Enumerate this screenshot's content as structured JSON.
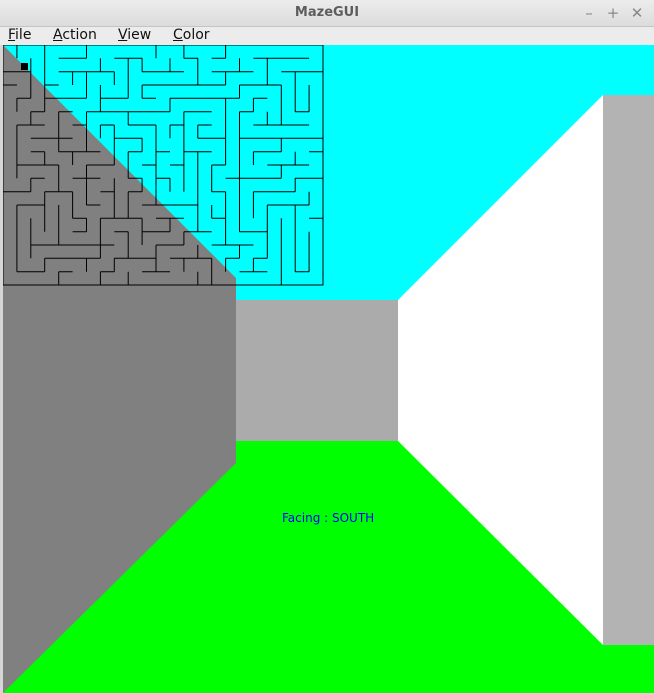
{
  "window": {
    "title": "MazeGUI"
  },
  "window_controls": {
    "minimize": "–",
    "maximize": "+",
    "close": "✕"
  },
  "menu": [
    {
      "label": "File",
      "mnemonic": "F",
      "rest": "ile"
    },
    {
      "label": "Action",
      "mnemonic": "A",
      "rest": "ction"
    },
    {
      "label": "View",
      "mnemonic": "V",
      "rest": "iew"
    },
    {
      "label": "Color",
      "mnemonic": "C",
      "rest": "olor"
    }
  ],
  "scene": {
    "colors": {
      "ceiling": "#00ffff",
      "floor": "#00ff00",
      "left_wall": "#808080",
      "front_wall": "#ababab",
      "right_wall": "#ffffff",
      "far_right_wall": "#b3b3b3",
      "minimap_line": "#000000",
      "player_marker": "#000000"
    },
    "facing_label": "Facing : SOUTH",
    "facing_color": "#0000ff"
  },
  "minimap": {
    "cols": 23,
    "rows": 18,
    "seed": 7
  }
}
